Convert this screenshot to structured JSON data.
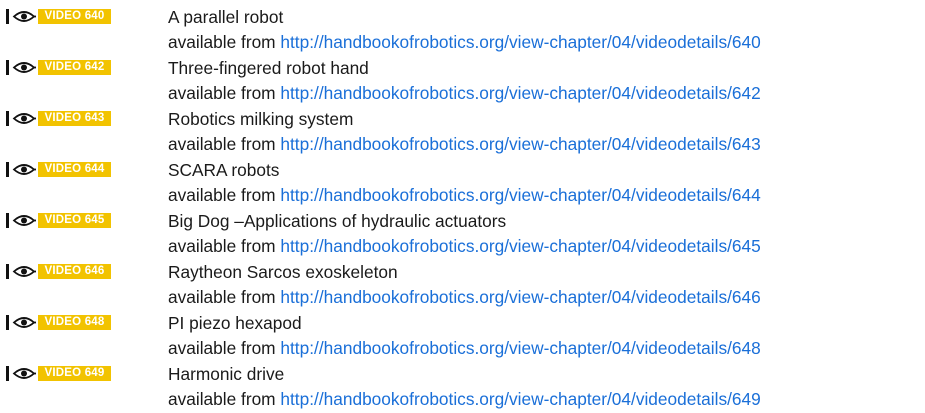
{
  "colors": {
    "tag_background": "#f2c300",
    "tag_text": "#ffffff",
    "link": "#1a6fd8",
    "text": "#1a1a1a"
  },
  "icon": "video-eye-icon",
  "available_prefix": "available from",
  "videos": [
    {
      "tag": "VIDEO 640",
      "title": "A parallel robot",
      "url": "http://handbookofrobotics.org/view-chapter/04/videodetails/640"
    },
    {
      "tag": "VIDEO 642",
      "title": "Three-fingered robot hand",
      "url": "http://handbookofrobotics.org/view-chapter/04/videodetails/642"
    },
    {
      "tag": "VIDEO 643",
      "title": "Robotics milking system",
      "url": "http://handbookofrobotics.org/view-chapter/04/videodetails/643"
    },
    {
      "tag": "VIDEO 644",
      "title": "SCARA robots",
      "url": "http://handbookofrobotics.org/view-chapter/04/videodetails/644"
    },
    {
      "tag": "VIDEO 645",
      "title": "Big Dog –Applications of hydraulic actuators",
      "url": "http://handbookofrobotics.org/view-chapter/04/videodetails/645"
    },
    {
      "tag": "VIDEO 646",
      "title": "Raytheon Sarcos exoskeleton",
      "url": "http://handbookofrobotics.org/view-chapter/04/videodetails/646"
    },
    {
      "tag": "VIDEO 648",
      "title": "PI piezo hexapod",
      "url": "http://handbookofrobotics.org/view-chapter/04/videodetails/648"
    },
    {
      "tag": "VIDEO 649",
      "title": "Harmonic drive",
      "url": "http://handbookofrobotics.org/view-chapter/04/videodetails/649"
    }
  ]
}
